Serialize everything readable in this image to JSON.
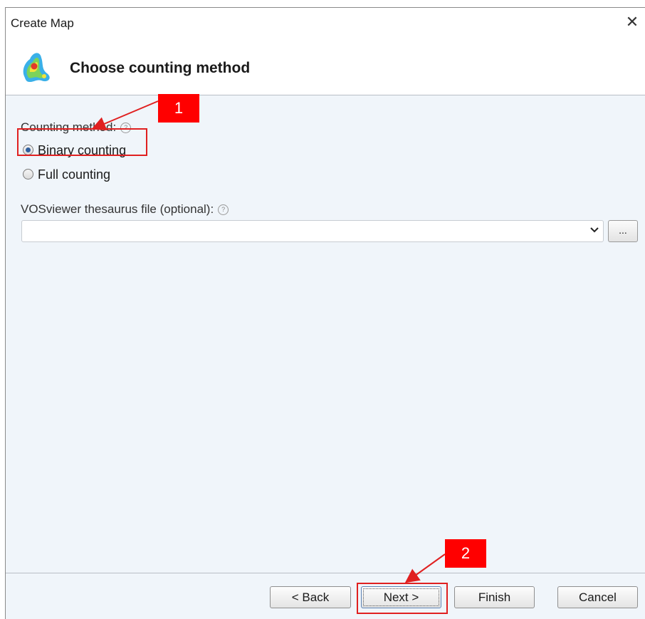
{
  "window": {
    "title": "Create Map"
  },
  "header": {
    "title": "Choose counting method",
    "icon": "vosviewer-density-icon"
  },
  "counting": {
    "label": "Counting method:",
    "options": [
      {
        "label": "Binary counting",
        "selected": true
      },
      {
        "label": "Full counting",
        "selected": false
      }
    ]
  },
  "thesaurus": {
    "label": "VOSviewer thesaurus file (optional):",
    "value": "",
    "browse_label": "..."
  },
  "footer": {
    "back": "< Back",
    "next": "Next >",
    "finish": "Finish",
    "cancel": "Cancel"
  },
  "annotations": {
    "badge1": "1",
    "badge2": "2",
    "color": "#ff0000"
  },
  "colors": {
    "panel_bg": "#f0f5fa",
    "radio_dot": "#2f5f9e"
  }
}
